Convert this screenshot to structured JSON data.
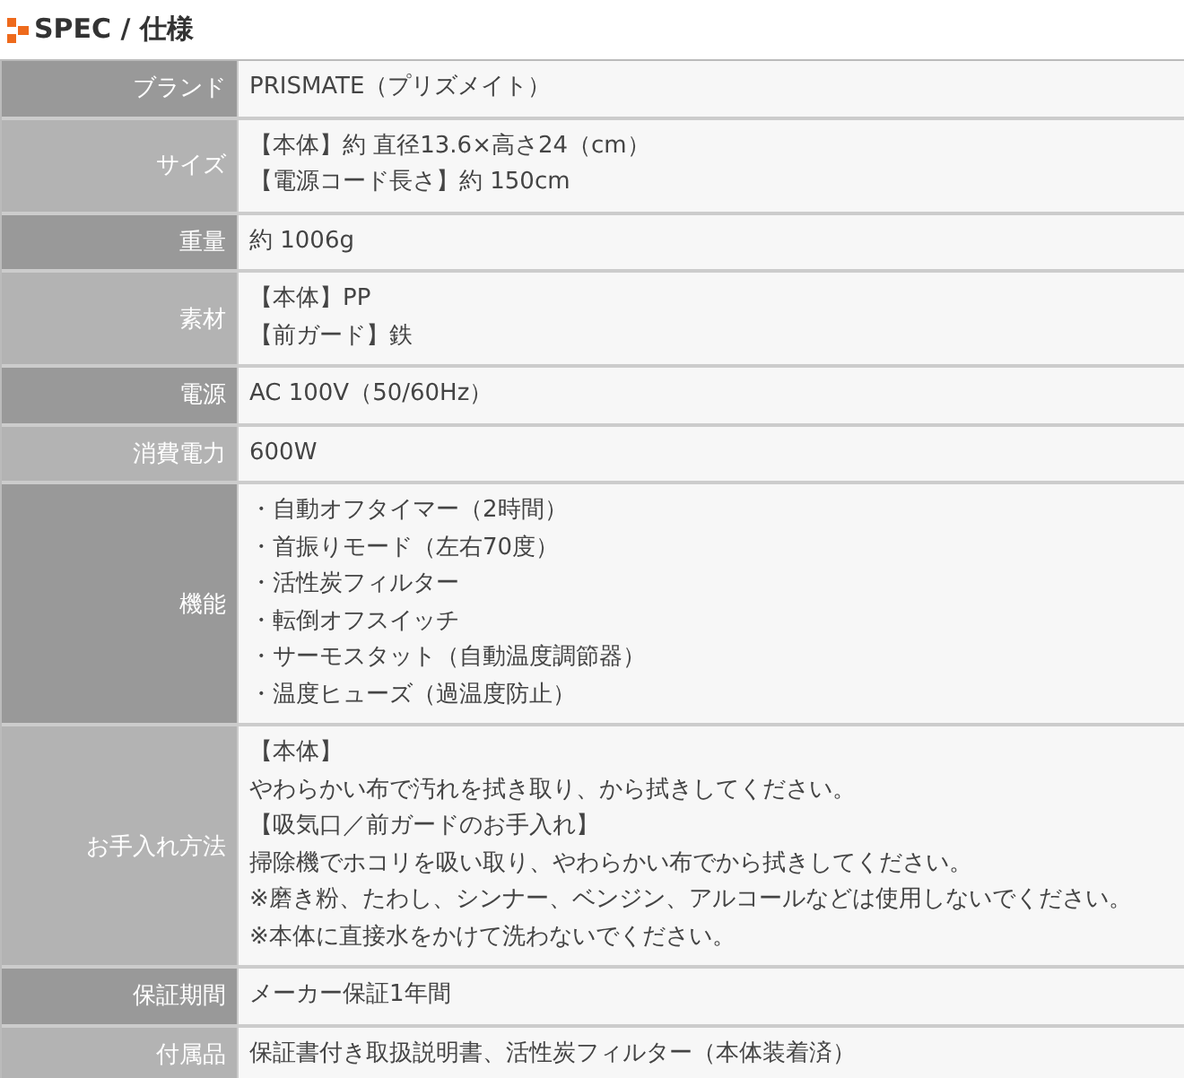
{
  "section": {
    "title": "SPEC / 仕様"
  },
  "rows": [
    {
      "label": "ブランド",
      "lines": [
        "PRISMATE（プリズメイト）"
      ]
    },
    {
      "label": "サイズ",
      "lines": [
        "【本体】約 直径13.6×高さ24（cm）",
        "【電源コード長さ】約 150cm"
      ]
    },
    {
      "label": "重量",
      "lines": [
        "約 1006g"
      ]
    },
    {
      "label": "素材",
      "lines": [
        "【本体】PP",
        "【前ガード】鉄"
      ]
    },
    {
      "label": "電源",
      "lines": [
        "AC 100V（50/60Hz）"
      ]
    },
    {
      "label": "消費電力",
      "lines": [
        "600W"
      ]
    },
    {
      "label": "機能",
      "lines": [
        "・自動オフタイマー（2時間）",
        "・首振りモード（左右70度）",
        "・活性炭フィルター",
        "・転倒オフスイッチ",
        "・サーモスタット（自動温度調節器）",
        "・温度ヒューズ（過温度防止）"
      ]
    },
    {
      "label": "お手入れ方法",
      "lines": [
        "【本体】",
        "やわらかい布で汚れを拭き取り、から拭きしてください。",
        "【吸気口／前ガードのお手入れ】",
        "掃除機でホコリを吸い取り、やわらかい布でから拭きしてください。",
        "※磨き粉、たわし、シンナー、ベンジン、アルコールなどは使用しないでください。",
        "※本体に直接水をかけて洗わないでください。"
      ]
    },
    {
      "label": "保証期間",
      "lines": [
        "メーカー保証1年間"
      ]
    },
    {
      "label": "付属品",
      "lines": [
        "保証書付き取扱説明書、活性炭フィルター（本体装着済）"
      ]
    }
  ]
}
